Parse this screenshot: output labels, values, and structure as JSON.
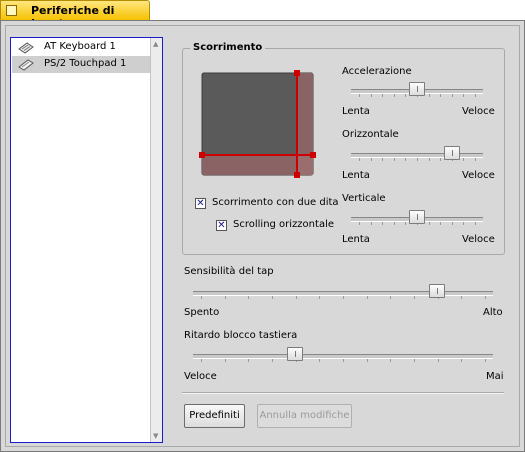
{
  "window": {
    "title": "Periferiche di Input"
  },
  "devices": [
    {
      "label": "AT Keyboard 1",
      "icon": "keyboard-icon"
    },
    {
      "label": "PS/2 Touchpad 1",
      "icon": "touchpad-icon",
      "selected": true
    }
  ],
  "scrolling": {
    "title": "Scorrimento",
    "two_finger_label": "Scorrimento con due dita",
    "two_finger_checked": true,
    "horizontal_label": "Scrolling orizzontale",
    "horizontal_checked": true,
    "acceleration": {
      "label": "Accelerazione",
      "min_label": "Lenta",
      "max_label": "Veloce",
      "value_fraction": 0.5
    },
    "horizontal": {
      "label": "Orizzontale",
      "min_label": "Lenta",
      "max_label": "Veloce",
      "value_fraction": 0.8
    },
    "vertical": {
      "label": "Verticale",
      "min_label": "Lenta",
      "max_label": "Veloce",
      "value_fraction": 0.5
    }
  },
  "tap_sensitivity": {
    "label": "Sensibilità del tap",
    "min_label": "Spento",
    "max_label": "Alto",
    "value_fraction": 0.83
  },
  "keyboard_lock_delay": {
    "label": "Ritardo blocco tastiera",
    "min_label": "Veloce",
    "max_label": "Mai",
    "value_fraction": 0.33
  },
  "buttons": {
    "defaults_label": "Predefiniti",
    "revert_label": "Annulla modifiche",
    "revert_enabled": false
  },
  "colors": {
    "tab_yellow": "#f6c200",
    "list_border": "#1a1acc",
    "pad_dark": "#5a5a5a",
    "pad_edge": "#8a6464",
    "scroll_line": "#cc0000"
  }
}
